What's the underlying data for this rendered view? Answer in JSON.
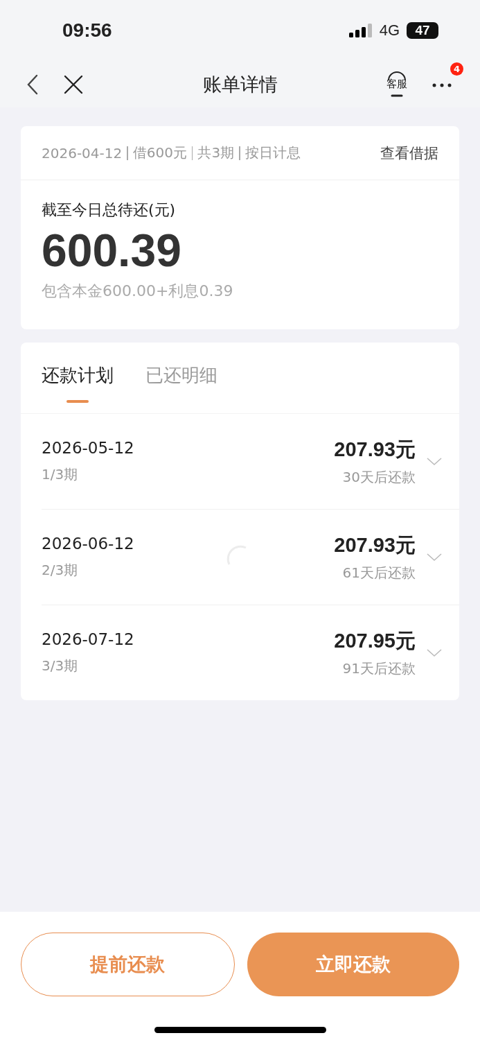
{
  "status_bar": {
    "time": "09:56",
    "network": "4G",
    "battery": "47"
  },
  "nav": {
    "title": "账单详情",
    "service_label": "客服",
    "badge": "4"
  },
  "summary": {
    "loan_date": "2026-04-12",
    "loan_amount": "借600元",
    "terms": "共3期",
    "interest_mode": "按日计息",
    "link": "查看借据",
    "total_label": "截至今日总待还(元)",
    "total": "600.39",
    "breakdown": "包含本金600.00+利息0.39"
  },
  "tabs": [
    {
      "label": "还款计划",
      "selected": true
    },
    {
      "label": "已还明细",
      "selected": false
    }
  ],
  "installments": [
    {
      "date": "2026-05-12",
      "period": "1/3期",
      "amount": "207.93元",
      "due": "30天后还款",
      "expanded": false
    },
    {
      "date": "2026-06-12",
      "period": "2/3期",
      "amount": "207.93元",
      "due": "61天后还款",
      "expanded": false
    },
    {
      "date": "2026-07-12",
      "period": "3/3期",
      "amount": "207.95元",
      "due": "91天后还款",
      "expanded": false
    }
  ],
  "buttons": [
    {
      "label": "提前还款",
      "kind": "outline"
    },
    {
      "label": "立即还款",
      "kind": "filled"
    }
  ]
}
